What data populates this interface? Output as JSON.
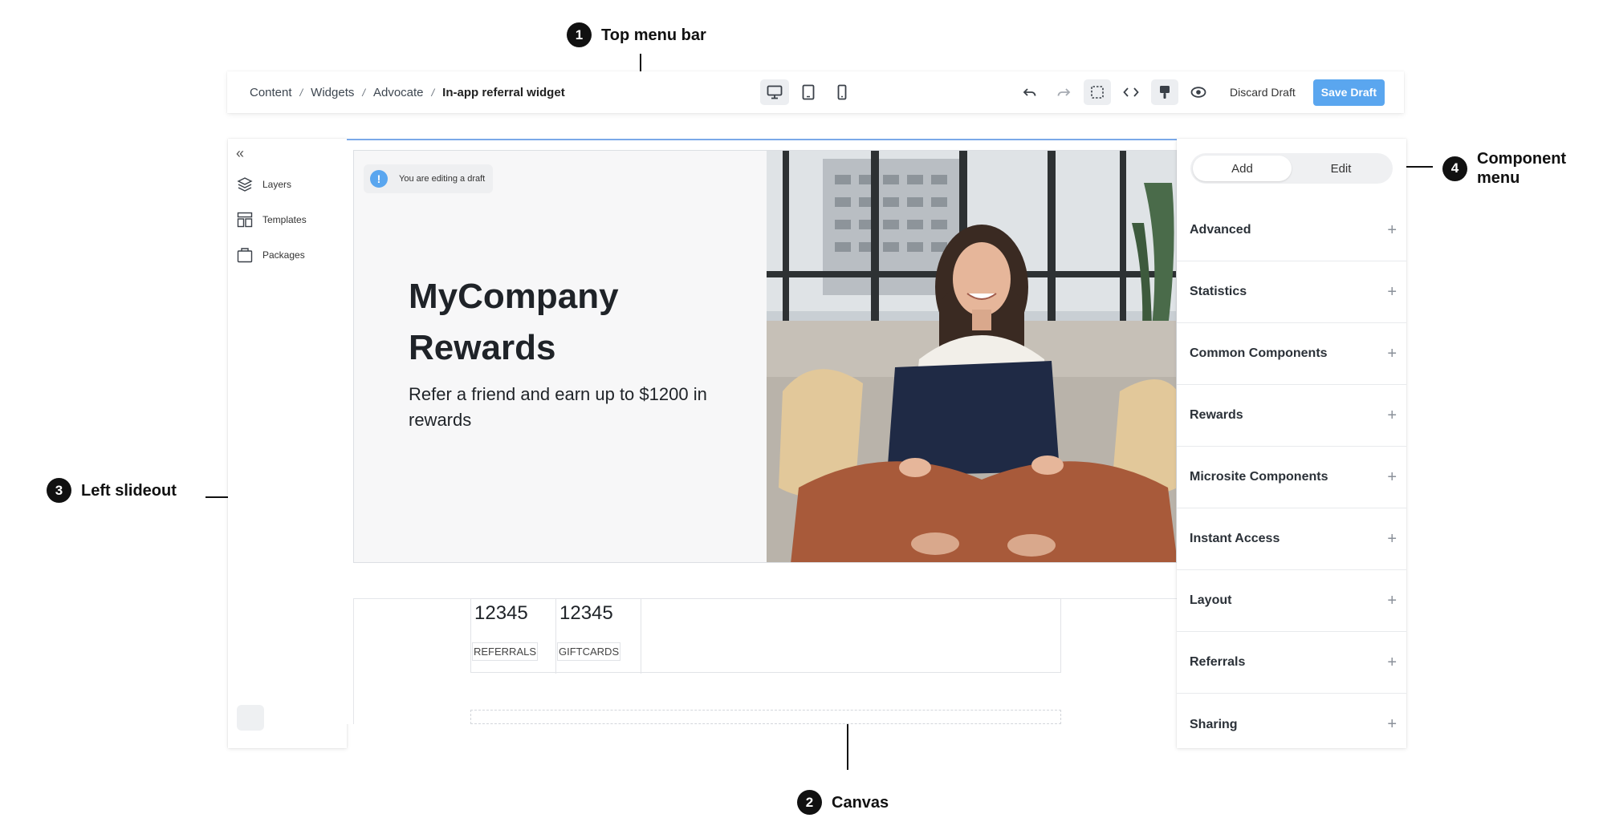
{
  "callouts": {
    "c1": {
      "num": "1",
      "label": "Top menu bar"
    },
    "c2": {
      "num": "2",
      "label": "Canvas"
    },
    "c3": {
      "num": "3",
      "label": "Left slideout"
    },
    "c4": {
      "num": "4",
      "label": "Component menu"
    }
  },
  "topbar": {
    "breadcrumb": [
      "Content",
      "Widgets",
      "Advocate",
      "In-app referral widget"
    ],
    "separator": "/",
    "devices": [
      "desktop-icon",
      "tablet-icon",
      "mobile-icon"
    ],
    "active_device": "desktop",
    "discard_label": "Discard Draft",
    "save_label": "Save Draft",
    "accent": "#5aa6ef"
  },
  "left_panel": {
    "collapse_glyph": "«",
    "items": [
      {
        "label": "Layers",
        "icon": "layers-icon"
      },
      {
        "label": "Templates",
        "icon": "templates-icon"
      },
      {
        "label": "Packages",
        "icon": "packages-icon"
      }
    ]
  },
  "canvas": {
    "draft_icon": "!",
    "draft_notice": "You are editing a draft",
    "hero_title": "MyCompany Rewards",
    "hero_subtitle": "Refer a friend and earn up to $1200 in rewards",
    "stats": [
      {
        "value": "12345",
        "label": "REFERRALS"
      },
      {
        "value": "12345",
        "label": "GIFTCARDS"
      }
    ]
  },
  "right_panel": {
    "tabs": [
      "Add",
      "Edit"
    ],
    "active_tab": "Add",
    "plus_glyph": "+",
    "items": [
      "Advanced",
      "Statistics",
      "Common Components",
      "Rewards",
      "Microsite Components",
      "Instant Access",
      "Layout",
      "Referrals",
      "Sharing"
    ]
  }
}
